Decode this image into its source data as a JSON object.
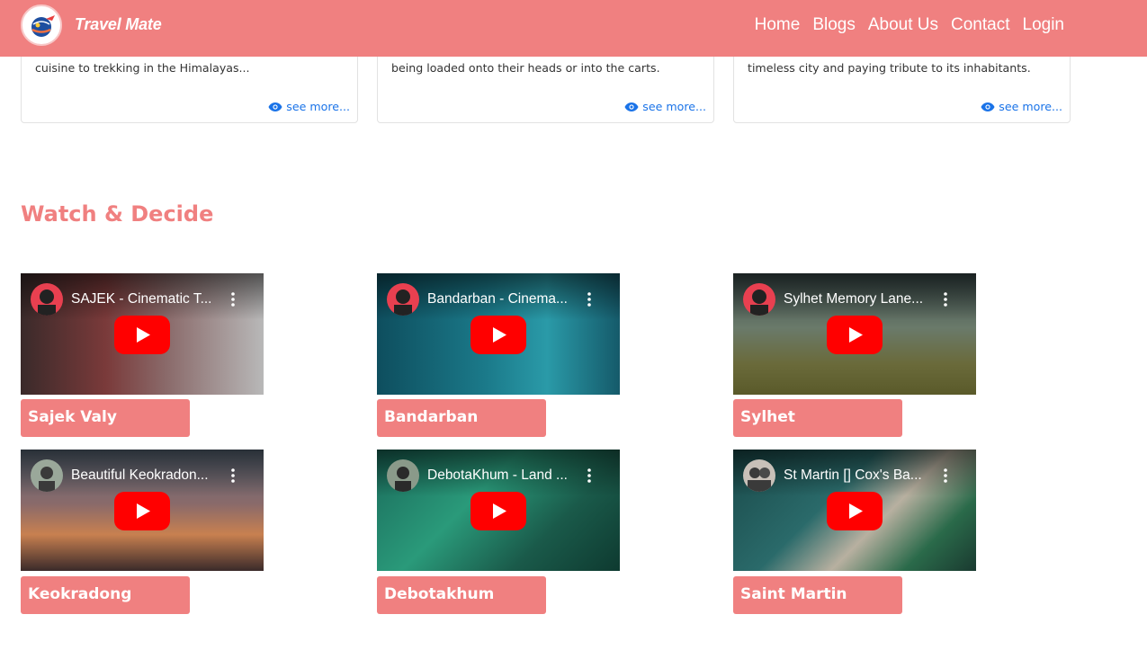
{
  "navbar": {
    "brand": "Travel Mate",
    "links": [
      "Home",
      "Blogs",
      "About Us",
      "Contact",
      "Login"
    ],
    "color": "#f08080"
  },
  "blog_cards": [
    {
      "text": "cuisine to trekking in the Himalayas...",
      "see_more": "see more..."
    },
    {
      "text": "being loaded onto their heads or into the carts.",
      "see_more": "see more..."
    },
    {
      "text": "timeless city and paying tribute to its inhabitants.",
      "see_more": "see more..."
    }
  ],
  "section": {
    "title": "Watch & Decide"
  },
  "videos": [
    {
      "title": "SAJEK - Cinematic T...",
      "label": "Sajek Valy"
    },
    {
      "title": "Bandarban - Cinema...",
      "label": "Bandarban"
    },
    {
      "title": "Sylhet Memory Lane...",
      "label": "Sylhet"
    },
    {
      "title": "Beautiful Keokradon...",
      "label": "Keokradong"
    },
    {
      "title": "DebotaKhum - Land ...",
      "label": "Debotakhum"
    },
    {
      "title": "St Martin [] Cox's Ba...",
      "label": "Saint Martin"
    }
  ],
  "colors": {
    "accent": "#f08080",
    "link": "#1a73e8",
    "youtube_red": "#ff0000"
  }
}
